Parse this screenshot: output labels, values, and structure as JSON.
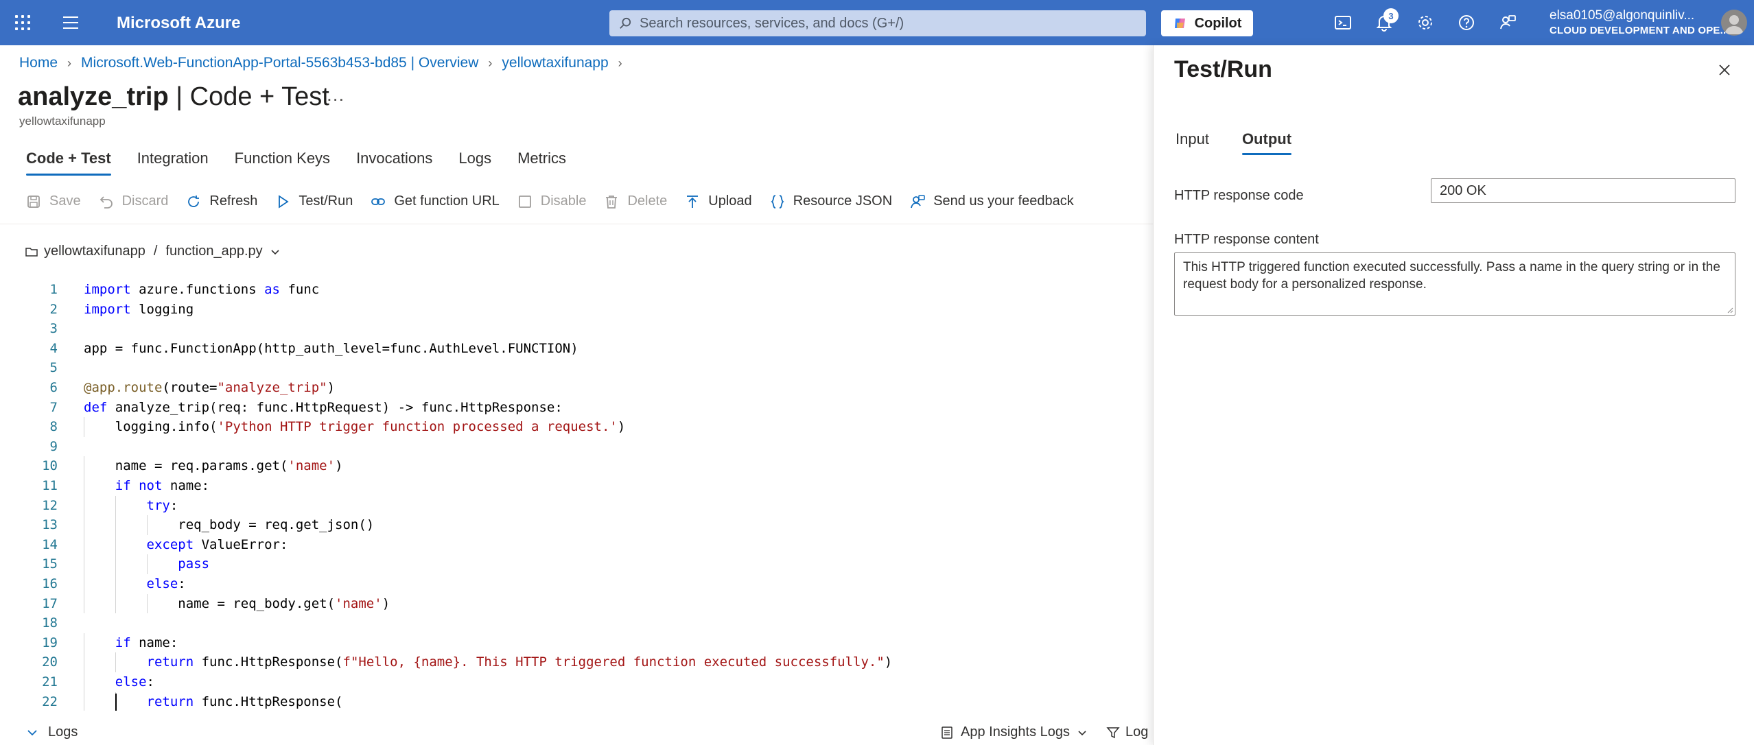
{
  "topbar": {
    "brand": "Microsoft Azure",
    "search_placeholder": "Search resources, services, and docs (G+/)",
    "copilot_label": "Copilot",
    "notification_count": "3",
    "user_email": "elsa0105@algonquinliv...",
    "user_directory": "CLOUD DEVELOPMENT AND OPE..."
  },
  "breadcrumb": {
    "items": [
      "Home",
      "Microsoft.Web-FunctionApp-Portal-5563b453-bd85 | Overview",
      "yellowtaxifunapp"
    ]
  },
  "page": {
    "title_bold": "analyze_trip",
    "title_rest": " | Code + Test",
    "more": "...",
    "subtitle": "yellowtaxifunapp"
  },
  "tabs": [
    "Code + Test",
    "Integration",
    "Function Keys",
    "Invocations",
    "Logs",
    "Metrics"
  ],
  "toolbar": {
    "save": "Save",
    "discard": "Discard",
    "refresh": "Refresh",
    "test_run": "Test/Run",
    "get_url": "Get function URL",
    "disable": "Disable",
    "delete": "Delete",
    "upload": "Upload",
    "resource_json": "Resource JSON",
    "feedback": "Send us your feedback"
  },
  "filepath": {
    "app": "yellowtaxifunapp",
    "separator": "/",
    "file": "function_app.py"
  },
  "code_lines": [
    "import azure.functions as func",
    "import logging",
    "",
    "app = func.FunctionApp(http_auth_level=func.AuthLevel.FUNCTION)",
    "",
    "@app.route(route=\"analyze_trip\")",
    "def analyze_trip(req: func.HttpRequest) -> func.HttpResponse:",
    "    logging.info('Python HTTP trigger function processed a request.')",
    "",
    "    name = req.params.get('name')",
    "    if not name:",
    "        try:",
    "            req_body = req.get_json()",
    "        except ValueError:",
    "            pass",
    "        else:",
    "            name = req_body.get('name')",
    "",
    "    if name:",
    "        return func.HttpResponse(f\"Hello, {name}. This HTTP triggered function executed successfully.\")",
    "    else:",
    "        return func.HttpResponse("
  ],
  "bottom": {
    "logs": "Logs",
    "app_insights": "App Insights Logs",
    "log_filter": "Log"
  },
  "panel": {
    "title": "Test/Run",
    "tabs": [
      "Input",
      "Output"
    ],
    "response_code_label": "HTTP response code",
    "response_code_value": "200 OK",
    "response_content_label": "HTTP response content",
    "response_content_value": "This HTTP triggered function executed successfully. Pass a name in the query string or in the request body for a personalized response."
  }
}
